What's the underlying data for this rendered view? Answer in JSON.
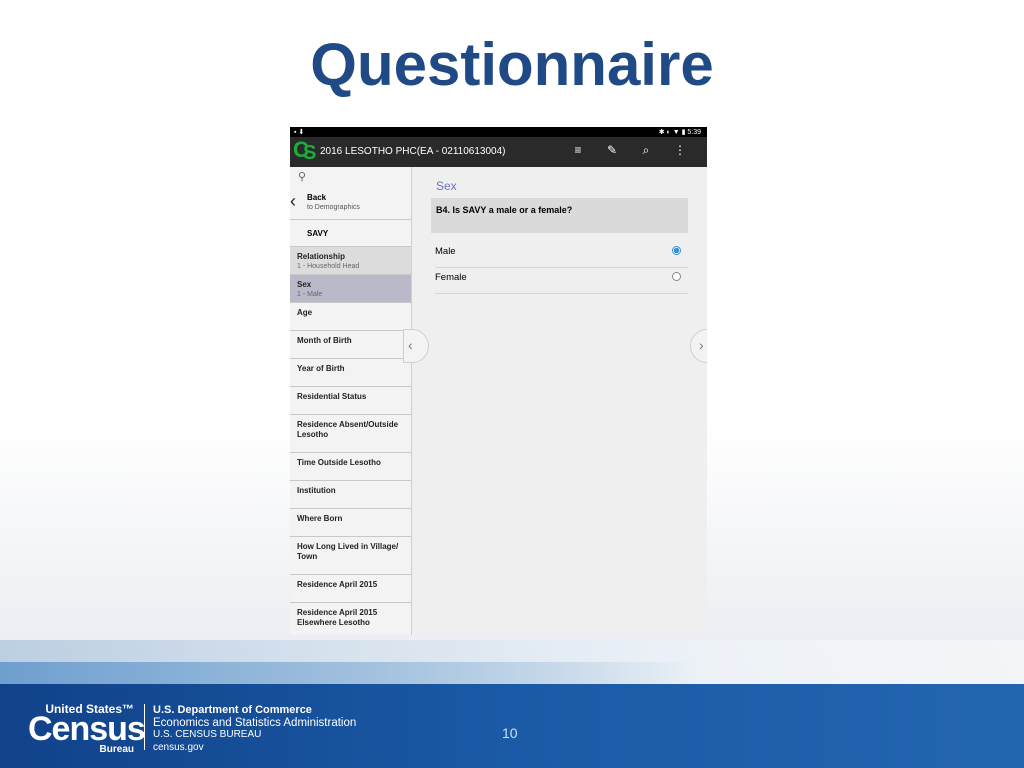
{
  "slide": {
    "title": "Questionnaire",
    "page_number": "10"
  },
  "footer": {
    "logo_top": "United States™",
    "logo_main": "Census",
    "logo_bottom": "Bureau",
    "dept_line1": "U.S. Department of Commerce",
    "dept_line2": "Economics and Statistics Administration",
    "dept_line3": "U.S. CENSUS BUREAU",
    "dept_line4": "census.gov"
  },
  "device": {
    "status_time": "5:39",
    "app_title": "2016 LESOTHO PHC(EA - 02110613004)",
    "sidebar": {
      "back_label": "Back",
      "back_sub": "to Demographics",
      "person": "SAVY",
      "items": [
        {
          "label": "Relationship",
          "sub": "1 - Household Head"
        },
        {
          "label": "Sex",
          "sub": "1 - Male"
        },
        {
          "label": "Age"
        },
        {
          "label": "Month of Birth"
        },
        {
          "label": "Year of  Birth"
        },
        {
          "label": "Residential Status"
        },
        {
          "label": "Residence Absent/Outside Lesotho"
        },
        {
          "label": "Time Outside Lesotho"
        },
        {
          "label": "Institution"
        },
        {
          "label": "Where Born"
        },
        {
          "label": "How Long Lived in Village/ Town"
        },
        {
          "label": "Residence April 2015"
        },
        {
          "label": "Residence April 2015 Elsewhere Lesotho"
        }
      ]
    },
    "question": {
      "section": "Sex",
      "text": "B4. Is SAVY a male or a female?",
      "options": [
        {
          "label": "Male",
          "selected": true
        },
        {
          "label": "Female",
          "selected": false
        }
      ]
    },
    "colors": {
      "accent": "#3b8fd9",
      "section_color": "#6a73c6"
    }
  }
}
